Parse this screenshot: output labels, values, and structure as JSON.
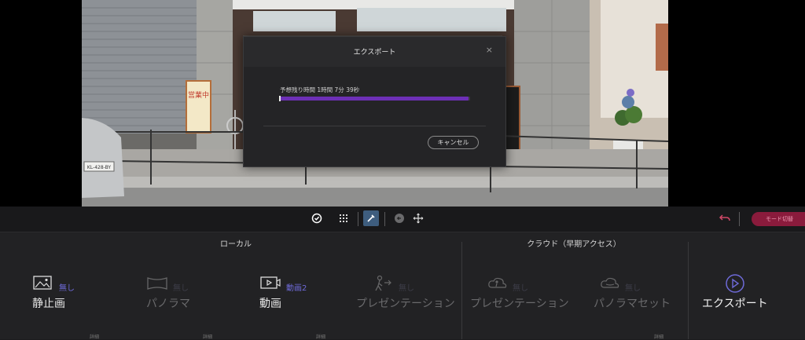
{
  "dialog": {
    "title": "エクスポート",
    "close_glyph": "×",
    "eta_text": "予想残り時間 1時間 7分 39秒",
    "progress_fraction": 0.99,
    "cancel_label": "キャンセル"
  },
  "scene": {
    "sign_text": "営業中",
    "plate_text": "KL-428-BY"
  },
  "toolbar": {
    "mode_label": "モード切替",
    "tools": [
      "check-circle-icon",
      "grid-dots-icon",
      "eyedropper-icon",
      "circle-arrow-icon",
      "move-icon"
    ],
    "active_tool": "eyedropper-icon",
    "undo_icon": "undo-icon"
  },
  "panel": {
    "local_title": "ローカル",
    "cloud_title": "クラウド（早期アクセス）",
    "detail_label": "詳細",
    "items": [
      {
        "label": "静止画",
        "badge": "無し",
        "icon": "image-icon",
        "enabled": true
      },
      {
        "label": "パノラマ",
        "badge": "無し",
        "icon": "panorama-icon",
        "enabled": false
      },
      {
        "label": "動画",
        "badge": "動画2",
        "icon": "video-icon",
        "enabled": true
      },
      {
        "label": "プレゼンテーション",
        "badge": "無し",
        "icon": "presentation-icon",
        "enabled": false
      },
      {
        "label": "プレゼンテーション",
        "badge": "無し",
        "icon": "cloud-presentation-icon",
        "enabled": false
      },
      {
        "label": "パノラマセット",
        "badge": "無し",
        "icon": "cloud-panorama-icon",
        "enabled": false
      }
    ],
    "export_label": "エクスポート"
  },
  "colors": {
    "accent_purple": "#6d2fb6",
    "badge_purple": "#6e6ad8",
    "mode_button": "#8a1b3c",
    "active_tool": "#3e5d7e"
  }
}
